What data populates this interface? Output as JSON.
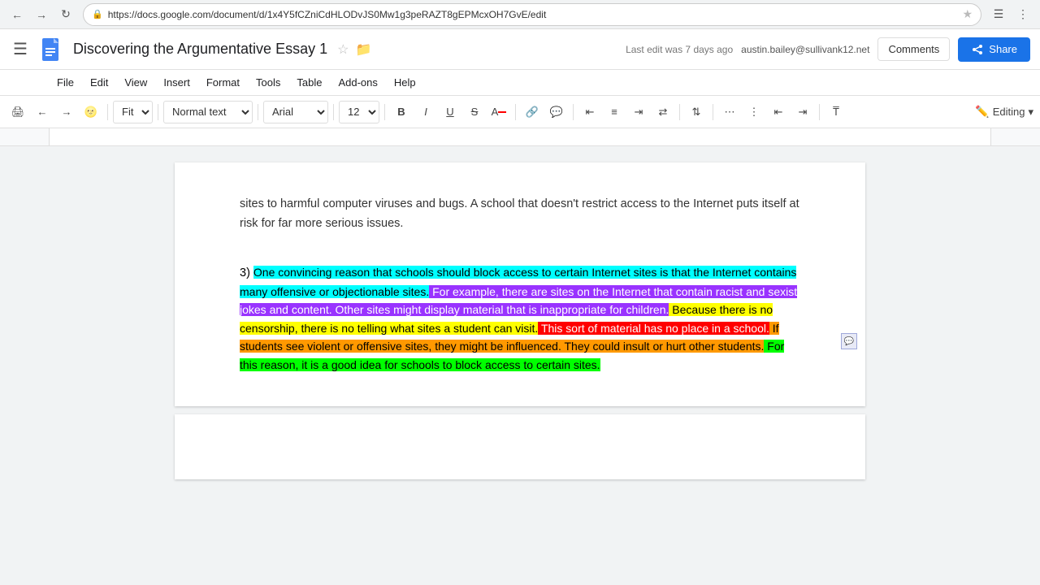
{
  "browser": {
    "url": "https://docs.google.com/document/d/1x4Y5fCZniCdHLODvJS0Mw1g3peRAZT8gEPMcxOH7GvE/edit",
    "secure_label": "Secure",
    "back_disabled": false,
    "forward_disabled": false
  },
  "app_bar": {
    "title": "Discovering the Argumentative Essay 1",
    "user_email": "austin.bailey@sullivank12.net",
    "last_edit": "Last edit was 7 days ago",
    "comments_label": "Comments",
    "share_label": "Share"
  },
  "menu": {
    "items": [
      "File",
      "Edit",
      "View",
      "Insert",
      "Format",
      "Tools",
      "Table",
      "Add-ons",
      "Help"
    ]
  },
  "toolbar": {
    "fit_label": "Fit",
    "text_style_label": "Normal text",
    "font_label": "Arial",
    "font_size": "12",
    "editing_label": "Editing"
  },
  "document": {
    "partial_top": "sites to harmful computer viruses and bugs. A school that doesn't restrict access to the Internet puts itself at risk for far more serious issues.",
    "paragraph_num": "3)",
    "paragraph_text": {
      "segment1_cyan": "One convincing reason that schools should block access to certain Internet sites is that the Internet contains many offensive or objectionable sites.",
      "segment2_purple": " For example, there are sites on the Internet that contain racist and sexist jokes and content. Other sites might display material that is inappropriate for children.",
      "segment3_yellow": " Because there is no censorship, there is no telling what sites a student can visit.",
      "segment4_red": " This sort of material has no place in a school.",
      "segment5_orange": " If students see violent or offensive sites, they might be influenced. They could insult or hurt other students.",
      "segment6_green": " For this reason, it is a good idea for schools to block access to certain sites."
    }
  }
}
